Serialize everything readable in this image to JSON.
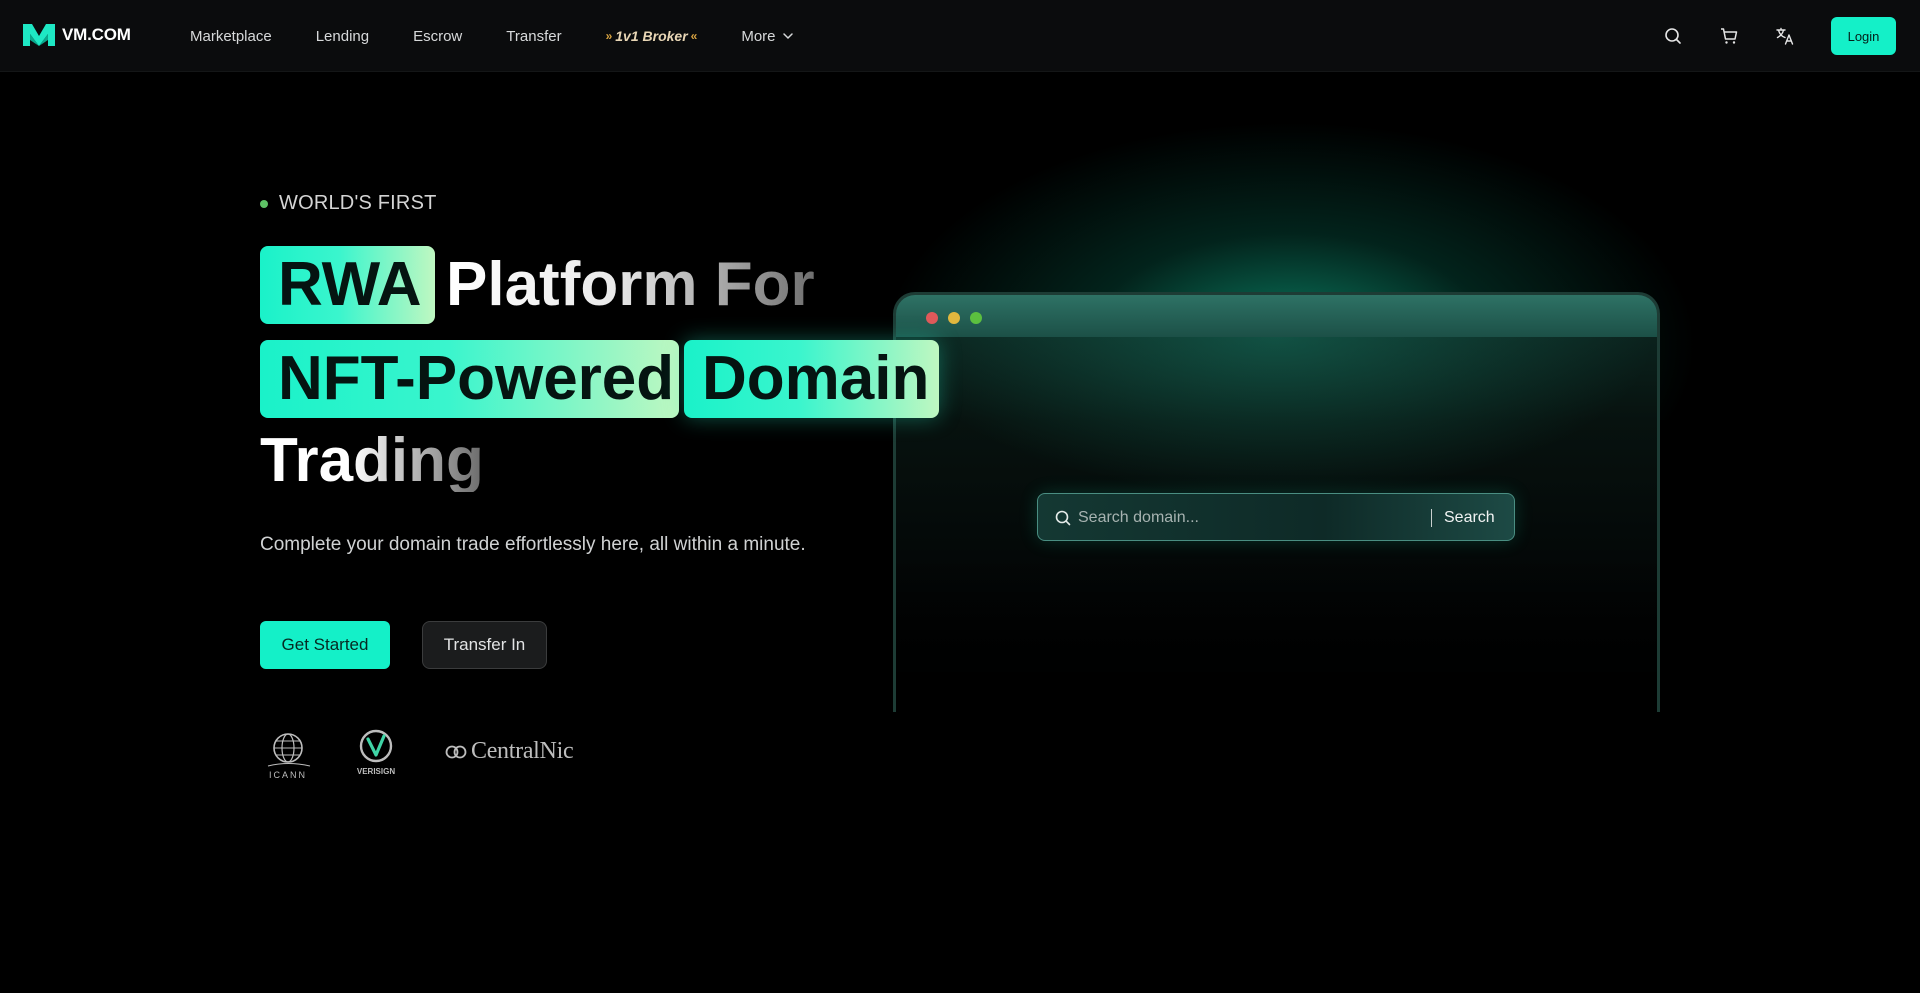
{
  "brand": {
    "name": "VM.COM",
    "accent": "#14f0c8"
  },
  "nav": {
    "links": [
      "Marketplace",
      "Lending",
      "Escrow",
      "Transfer"
    ],
    "broker": {
      "arrows_left": "»",
      "label": "1v1 Broker",
      "arrows_right": "«"
    },
    "more": "More",
    "icons": [
      "search-icon",
      "cart-icon",
      "translate-icon"
    ],
    "login": "Login"
  },
  "hero": {
    "eyebrow": "WORLD'S FIRST",
    "headline": {
      "rwa": "RWA",
      "platform_for": "Platform For",
      "nft_powered": "NFT-Powered",
      "domain": "Domain",
      "trading": "Trading"
    },
    "subtitle": "Complete your domain trade effortlessly here, all within a minute.",
    "primary_cta": "Get Started",
    "secondary_cta": "Transfer In",
    "partners": {
      "icann": "ICANN",
      "verisign": "VERISIGN",
      "centralnic": "CentralNic"
    }
  },
  "search": {
    "placeholder": "Search domain...",
    "value": "",
    "button": "Search"
  }
}
